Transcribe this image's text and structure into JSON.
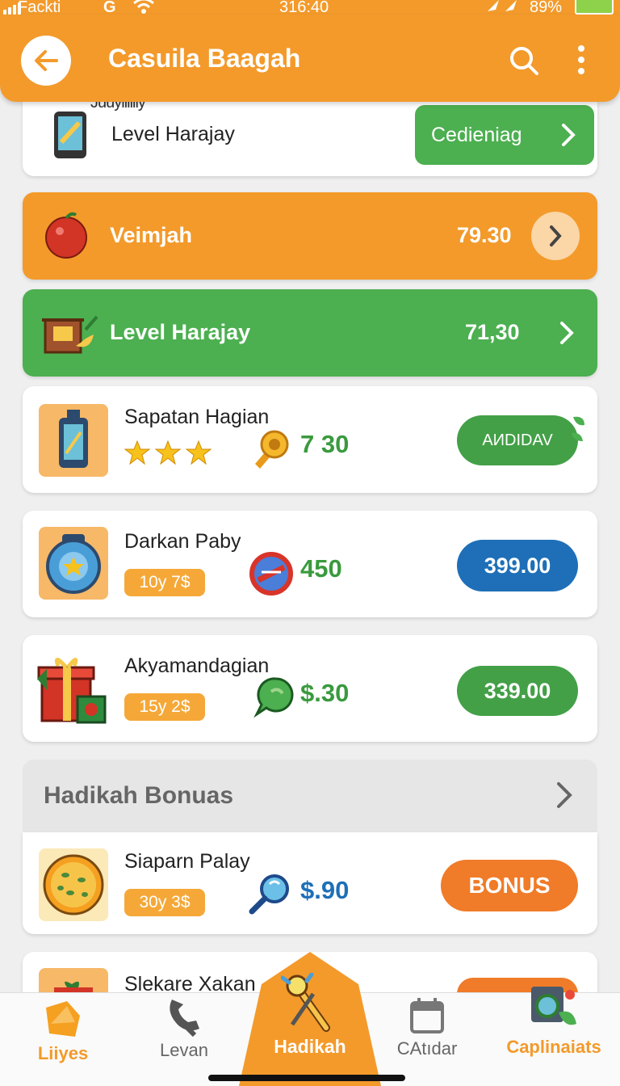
{
  "status_bar": {
    "carrier": "Fackti",
    "network": "G",
    "time": "316:40",
    "battery": "89%"
  },
  "header": {
    "title": "Casuila Baagah"
  },
  "top_card": {
    "subtitle": "Juuyiiiiiiy",
    "label": "Level Harajay",
    "button": "Cedieniag"
  },
  "banner_orange": {
    "label": "Veimjah",
    "value": "79.30"
  },
  "banner_green": {
    "label": "Level Harajay",
    "value": "71,30"
  },
  "products": [
    {
      "name": "Sapatan Hagian",
      "rating": 3,
      "value": "7 30",
      "button": "AИDIDAV",
      "button_color": "#43a047"
    },
    {
      "name": "Darkan Paby",
      "tag": "10y 7$",
      "value": "450",
      "button": "399.00",
      "button_color": "#1e6fb8"
    },
    {
      "name": "Akyamandagian",
      "tag": "15y 2$",
      "value": "$.30",
      "button": "339.00",
      "button_color": "#43a047"
    }
  ],
  "bonus_section": {
    "title": "Hadikah Bonuas"
  },
  "bonus_items": [
    {
      "name": "Siaparn Palay",
      "tag": "30y 3$",
      "value": "$.90",
      "button": "BONUS",
      "button_color": "#f07b28"
    },
    {
      "name": "Slekare Xakan"
    }
  ],
  "bottom_nav": [
    {
      "label": "Liiyes",
      "active": false
    },
    {
      "label": "Levan",
      "active": false
    },
    {
      "label": "Hadikah",
      "active": true
    },
    {
      "label": "CAtıdar",
      "active": false
    },
    {
      "label": "Caplinaiats",
      "active": false
    }
  ],
  "colors": {
    "primary": "#f39a2b",
    "green": "#4caf50",
    "blue": "#1e6fb8",
    "bonus": "#f07b28"
  }
}
